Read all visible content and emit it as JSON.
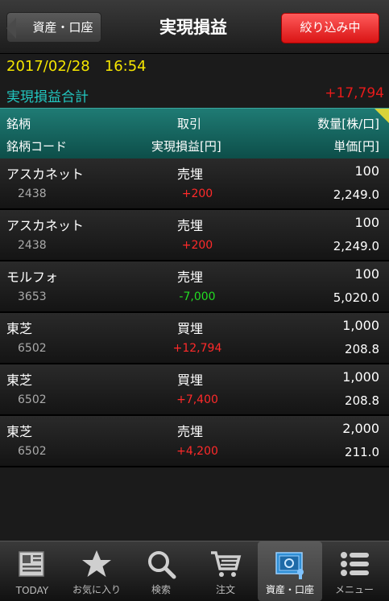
{
  "topbar": {
    "back_label": "資産・口座",
    "title": "実現損益",
    "filter_label": "絞り込み中"
  },
  "summary": {
    "date": "2017/02/28",
    "time": "16:54",
    "total_label": "実現損益合計",
    "total_value": "+17,794"
  },
  "header": {
    "name": "銘柄",
    "trade": "取引",
    "qty": "数量[株/口]",
    "code": "銘柄コード",
    "pnl": "実現損益[円]",
    "price": "単価[円]"
  },
  "rows": [
    {
      "name": "アスカネット",
      "trade": "売埋",
      "qty": "100",
      "code": "2438",
      "pnl": "+200",
      "price": "2,249.0"
    },
    {
      "name": "アスカネット",
      "trade": "売埋",
      "qty": "100",
      "code": "2438",
      "pnl": "+200",
      "price": "2,249.0"
    },
    {
      "name": "モルフォ",
      "trade": "売埋",
      "qty": "100",
      "code": "3653",
      "pnl": "-7,000",
      "price": "5,020.0"
    },
    {
      "name": "東芝",
      "trade": "買埋",
      "qty": "1,000",
      "code": "6502",
      "pnl": "+12,794",
      "price": "208.8"
    },
    {
      "name": "東芝",
      "trade": "買埋",
      "qty": "1,000",
      "code": "6502",
      "pnl": "+7,400",
      "price": "208.8"
    },
    {
      "name": "東芝",
      "trade": "売埋",
      "qty": "2,000",
      "code": "6502",
      "pnl": "+4,200",
      "price": "211.0"
    }
  ],
  "tabs": [
    {
      "label": "TODAY",
      "icon": "newspaper-icon"
    },
    {
      "label": "お気に入り",
      "icon": "star-icon"
    },
    {
      "label": "検索",
      "icon": "magnifier-icon"
    },
    {
      "label": "注文",
      "icon": "cart-icon"
    },
    {
      "label": "資産・口座",
      "icon": "safe-icon"
    },
    {
      "label": "メニュー",
      "icon": "menu-icon"
    }
  ],
  "colors": {
    "accent_teal": "#22c7c0",
    "date_yellow": "#f5e600",
    "profit_red": "#ff2a2a",
    "loss_green": "#22dd22",
    "filter_red": "#e81b1b"
  }
}
